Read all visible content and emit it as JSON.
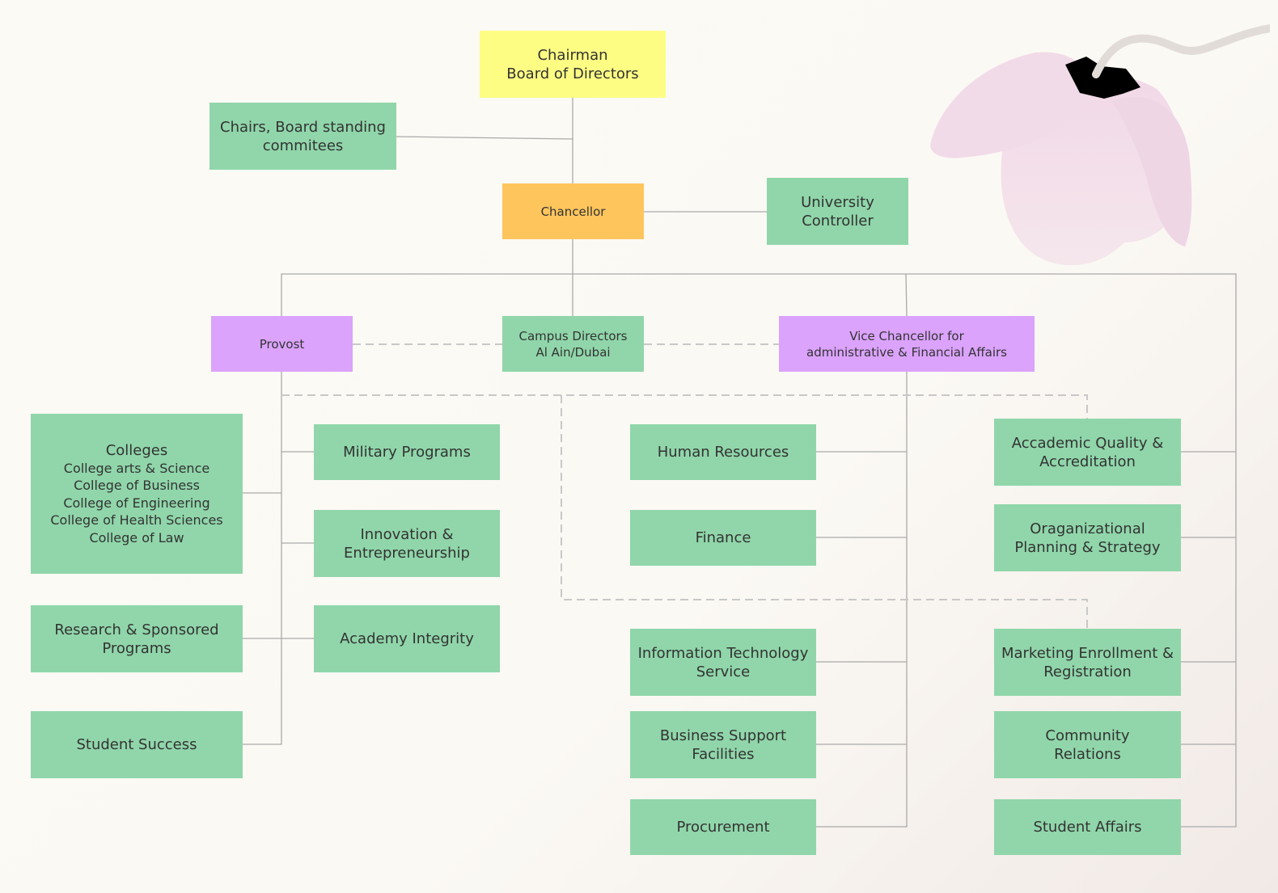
{
  "nodes": {
    "chairman": {
      "line1": "Chairman",
      "line2": "Board of Directors"
    },
    "chairs": {
      "line1": "Chairs, Board standing",
      "line2": "commitees"
    },
    "chancellor": "Chancellor",
    "controller": {
      "line1": "University",
      "line2": "Controller"
    },
    "provost": "Provost",
    "campus": {
      "line1": "Campus Directors",
      "line2": "Al Ain/Dubai"
    },
    "vice_chancellor": {
      "line1": "Vice Chancellor for",
      "line2": "administrative & Financial Affairs"
    },
    "colleges": {
      "title": "Colleges",
      "items": [
        "College arts & Science",
        "College of Business",
        "College of Engineering",
        "College of Health Sciences",
        "College of Law"
      ]
    },
    "research": {
      "line1": "Research & Sponsored",
      "line2": "Programs"
    },
    "student_success": "Student Success",
    "military": "Military Programs",
    "innovation": {
      "line1": "Innovation &",
      "line2": "Entrepreneurship"
    },
    "academy": "Academy Integrity",
    "hr": "Human Resources",
    "finance": "Finance",
    "it": {
      "line1": "Information Technology",
      "line2": "Service"
    },
    "business": {
      "line1": "Business Support",
      "line2": "Facilities"
    },
    "procurement": "Procurement",
    "quality": {
      "line1": "Accademic Quality &",
      "line2": "Accreditation"
    },
    "planning": {
      "line1": "Oraganizational",
      "line2": "Planning & Strategy"
    },
    "marketing": {
      "line1": "Marketing Enrollment &",
      "line2": "Registration"
    },
    "community": {
      "line1": "Community",
      "line2": "Relations"
    },
    "student_affairs": "Student Affairs"
  },
  "colors": {
    "green": "#90d6aa",
    "yellow": "#fdfd84",
    "orange": "#fec55d",
    "purple": "#dba3fc",
    "connector": "#aaaaaa"
  }
}
